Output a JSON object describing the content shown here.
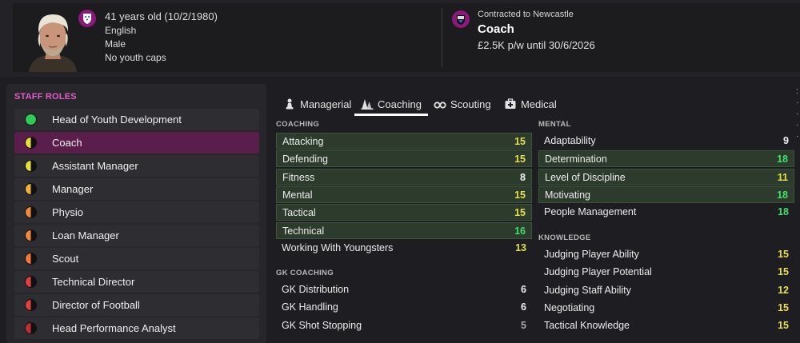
{
  "profile": {
    "age_line": "41 years old (10/2/1980)",
    "nationality": "English",
    "gender": "Male",
    "youth_caps": "No youth caps",
    "contract_line": "Contracted to Newcastle",
    "job_title": "Coach",
    "wage_line": "£2.5K p/w until 30/6/2026"
  },
  "roles": {
    "title": "STAFF ROLES",
    "items": [
      {
        "label": "Head of Youth Development",
        "suitability": "full",
        "color": "#2ecc55"
      },
      {
        "label": "Coach",
        "suitability": "half",
        "color": "#e8e03a",
        "selected": true
      },
      {
        "label": "Assistant Manager",
        "suitability": "half",
        "color": "#e8e03a"
      },
      {
        "label": "Manager",
        "suitability": "half",
        "color": "#f0b03a"
      },
      {
        "label": "Physio",
        "suitability": "half",
        "color": "#f08a3a"
      },
      {
        "label": "Loan Manager",
        "suitability": "half",
        "color": "#f08a3a"
      },
      {
        "label": "Scout",
        "suitability": "half",
        "color": "#ee7a3a"
      },
      {
        "label": "Technical Director",
        "suitability": "half",
        "color": "#e04040"
      },
      {
        "label": "Director of Football",
        "suitability": "half",
        "color": "#e04040"
      },
      {
        "label": "Head Performance Analyst",
        "suitability": "half",
        "color": "#c03030"
      }
    ]
  },
  "tabs": [
    {
      "label": "Managerial",
      "icon": "chess-pawn-icon"
    },
    {
      "label": "Coaching",
      "icon": "cones-icon",
      "active": true
    },
    {
      "label": "Scouting",
      "icon": "binoculars-icon"
    },
    {
      "label": "Medical",
      "icon": "medical-kit-icon"
    }
  ],
  "sections": {
    "coaching": {
      "title": "COACHING",
      "items": [
        {
          "label": "Attacking",
          "value": "15",
          "highlight": true,
          "color": "yellow"
        },
        {
          "label": "Defending",
          "value": "15",
          "highlight": true,
          "color": "yellow"
        },
        {
          "label": "Fitness",
          "value": "8",
          "highlight": true,
          "color": "white"
        },
        {
          "label": "Mental",
          "value": "15",
          "highlight": true,
          "color": "yellow"
        },
        {
          "label": "Tactical",
          "value": "15",
          "highlight": true,
          "color": "yellow"
        },
        {
          "label": "Technical",
          "value": "16",
          "highlight": true,
          "color": "green"
        },
        {
          "label": "Working With Youngsters",
          "value": "13",
          "highlight": false,
          "color": "yellow"
        }
      ]
    },
    "gk_coaching": {
      "title": "GK COACHING",
      "items": [
        {
          "label": "GK Distribution",
          "value": "6",
          "color": "white"
        },
        {
          "label": "GK Handling",
          "value": "6",
          "color": "white"
        },
        {
          "label": "GK Shot Stopping",
          "value": "5",
          "color": "grey"
        }
      ]
    },
    "mental": {
      "title": "MENTAL",
      "items": [
        {
          "label": "Adaptability",
          "value": "9",
          "highlight": false,
          "color": "white"
        },
        {
          "label": "Determination",
          "value": "18",
          "highlight": true,
          "color": "green"
        },
        {
          "label": "Level of Discipline",
          "value": "11",
          "highlight": true,
          "color": "yellow"
        },
        {
          "label": "Motivating",
          "value": "18",
          "highlight": true,
          "color": "green"
        },
        {
          "label": "People Management",
          "value": "18",
          "highlight": false,
          "color": "green"
        }
      ]
    },
    "knowledge": {
      "title": "KNOWLEDGE",
      "items": [
        {
          "label": "Judging Player Ability",
          "value": "15",
          "color": "yellow"
        },
        {
          "label": "Judging Player Potential",
          "value": "15",
          "color": "yellow"
        },
        {
          "label": "Judging Staff Ability",
          "value": "12",
          "color": "yellow"
        },
        {
          "label": "Negotiating",
          "value": "15",
          "color": "yellow"
        },
        {
          "label": "Tactical Knowledge",
          "value": "15",
          "color": "yellow"
        }
      ]
    }
  }
}
